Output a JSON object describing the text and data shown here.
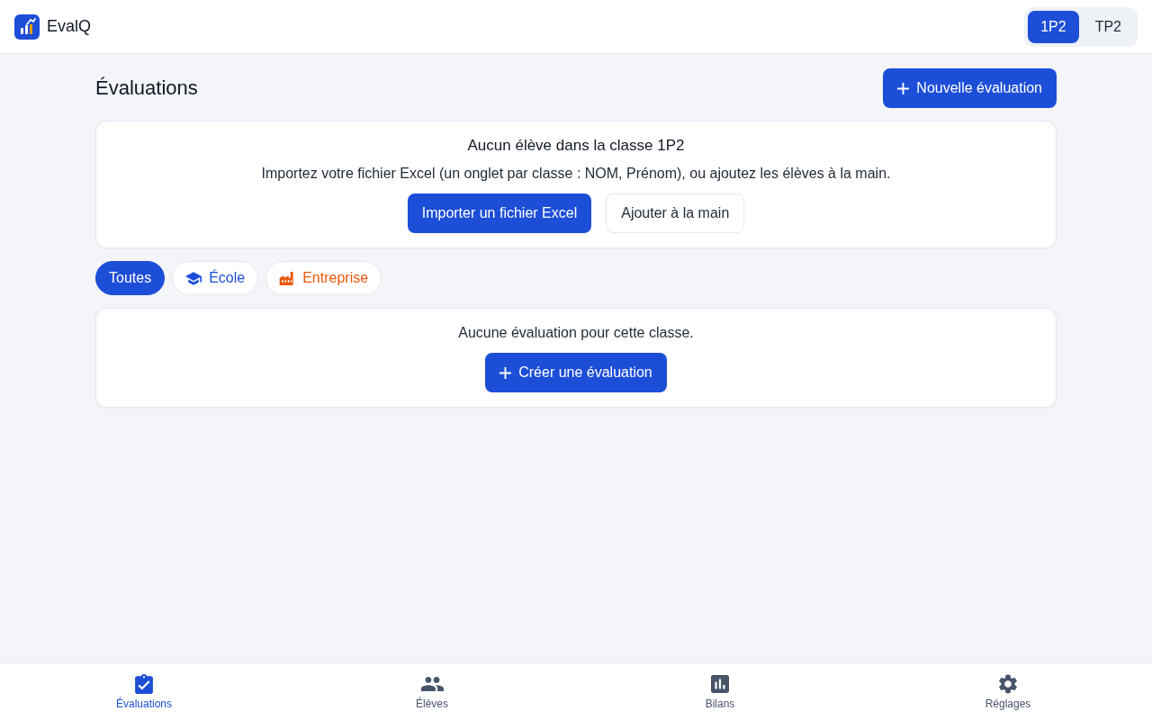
{
  "header": {
    "app_name": "EvalQ",
    "classes": [
      {
        "label": "1P2",
        "selected": true
      },
      {
        "label": "TP2",
        "selected": false
      }
    ]
  },
  "page": {
    "title": "Évaluations",
    "new_button": "Nouvelle évaluation"
  },
  "empty_students": {
    "title": "Aucun élève dans la classe 1P2",
    "message": "Importez votre fichier Excel (un onglet par classe : NOM, Prénom), ou ajoutez les élèves à la main.",
    "buttons": [
      {
        "label": "Importer un fichier Excel",
        "kind": "primary"
      },
      {
        "label": "Ajouter à la main",
        "kind": "secondary"
      }
    ]
  },
  "filters": [
    {
      "label": "Toutes",
      "kind": "all",
      "selected": true
    },
    {
      "label": "École",
      "kind": "school",
      "selected": false
    },
    {
      "label": "Entreprise",
      "kind": "company",
      "selected": false
    }
  ],
  "empty_evaluations": {
    "message": "Aucune évaluation pour cette classe.",
    "button": "Créer une évaluation"
  },
  "bottom_nav": [
    {
      "label": "Évaluations",
      "kind": "evaluations",
      "selected": true
    },
    {
      "label": "Élèves",
      "kind": "students",
      "selected": false
    },
    {
      "label": "Bilans",
      "kind": "reports",
      "selected": false
    },
    {
      "label": "Réglages",
      "kind": "settings",
      "selected": false
    }
  ]
}
